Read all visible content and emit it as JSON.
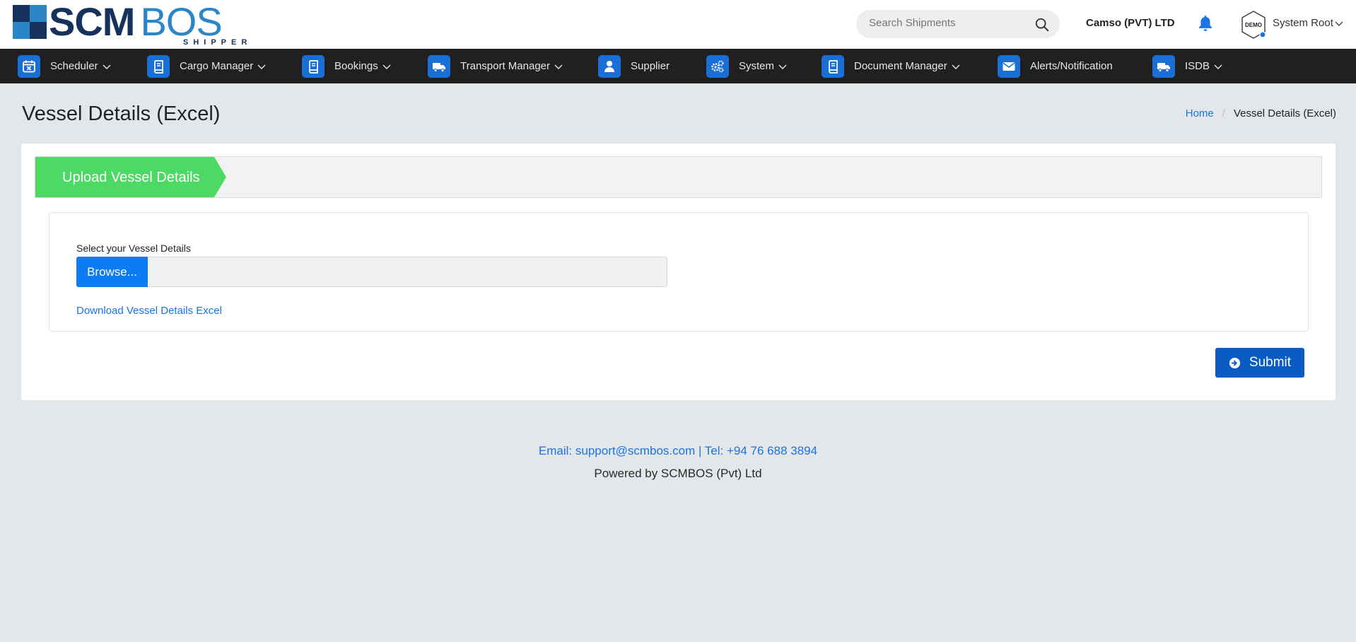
{
  "logo": {
    "primary": "SCM",
    "secondary": "BOS",
    "tagline": "SHIPPER",
    "colors": [
      "#16325c",
      "#2a86c7",
      "#2a86c7",
      "#16325c"
    ]
  },
  "header": {
    "search_placeholder": "Search Shipments",
    "company": "Camso (PVT) LTD",
    "avatar_text": "DEMO",
    "user_name": "System Root"
  },
  "nav": {
    "items": [
      {
        "label": "Scheduler",
        "icon": "calendar-icon",
        "has_dropdown": true
      },
      {
        "label": "Cargo Manager",
        "icon": "book-icon",
        "has_dropdown": true
      },
      {
        "label": "Bookings",
        "icon": "book-icon",
        "has_dropdown": true
      },
      {
        "label": "Transport Manager",
        "icon": "truck-icon",
        "has_dropdown": true
      },
      {
        "label": "Supplier",
        "icon": "user-icon",
        "has_dropdown": false
      },
      {
        "label": "System",
        "icon": "gears-icon",
        "has_dropdown": true
      },
      {
        "label": "Document Manager",
        "icon": "book-icon",
        "has_dropdown": true
      },
      {
        "label": "Alerts/Notification",
        "icon": "envelope-icon",
        "has_dropdown": false
      },
      {
        "label": "ISDB",
        "icon": "truck-icon",
        "has_dropdown": true
      }
    ]
  },
  "page": {
    "title": "Vessel Details (Excel)",
    "breadcrumb_home": "Home",
    "breadcrumb_sep": "/",
    "breadcrumb_current": "Vessel Details (Excel)"
  },
  "upload": {
    "step_label": "Upload Vessel Details",
    "field_label": "Select your Vessel Details",
    "browse_label": "Browse...",
    "file_name": "",
    "download_link": "Download Vessel Details Excel",
    "submit_label": "Submit"
  },
  "footer": {
    "contact": "Email: support@scmbos.com | Tel: +94 76 688 3894",
    "powered": "Powered by SCMBOS (Pvt) Ltd"
  },
  "colors": {
    "accent_blue": "#1a73e8",
    "nav_bg": "#202020",
    "nav_icon_bg": "#1a6fd6",
    "step_green": "#4cd964",
    "submit_bg": "#0a5cc4",
    "browse_bg": "#0d7bf2",
    "page_bg": "#e3e7e9"
  }
}
